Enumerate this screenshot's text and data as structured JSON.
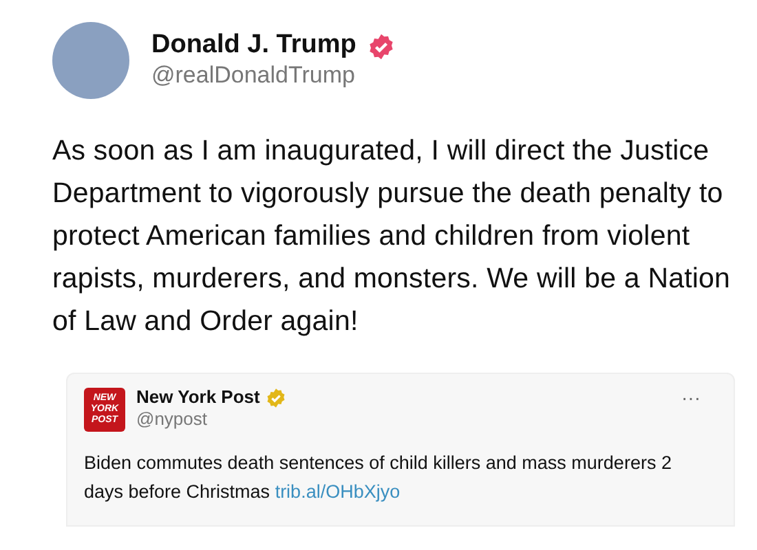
{
  "author": {
    "name": "Donald J. Trump",
    "handle": "@realDonaldTrump",
    "verified": true
  },
  "post_text": "As soon as I am inaugurated, I will direct the Justice Department to vigorously pursue the death penalty to protect American families and children from violent rapists, murderers, and monsters. We will be a Nation of Law and Order again!",
  "quoted_post": {
    "logo_lines": [
      "NEW",
      "YORK",
      "POST"
    ],
    "name": "New York Post",
    "handle": "@nypost",
    "verified": true,
    "more": "···",
    "text": "Biden commutes death sentences of child killers and mass murderers 2 days before Christmas",
    "link": "trib.al/OHbXjyo"
  }
}
